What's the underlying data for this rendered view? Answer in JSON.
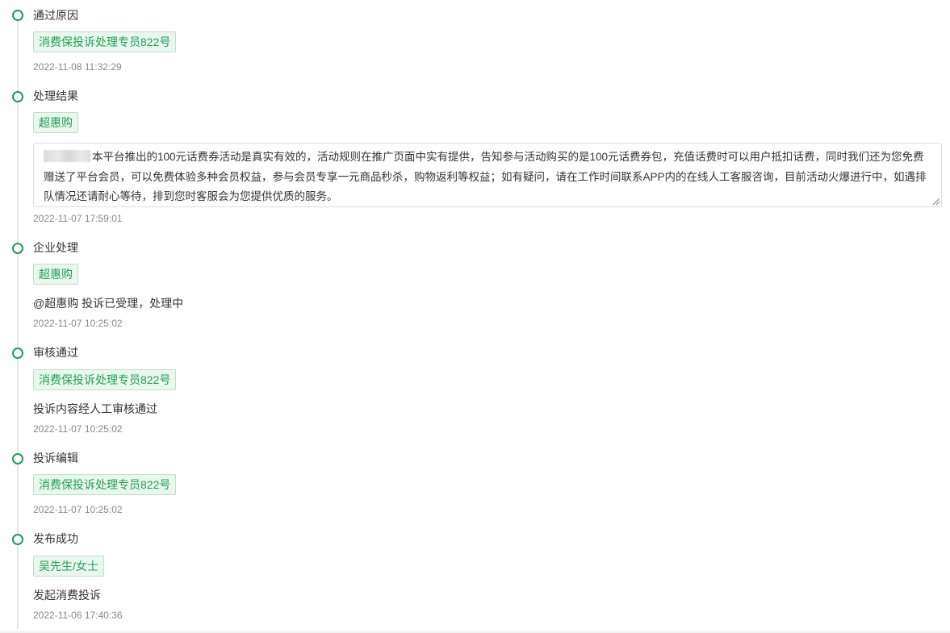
{
  "colors": {
    "accent_green": "#1e9a58",
    "tag_bg": "#e9f7ef",
    "tag_border": "#b8e3c8",
    "tag_text": "#22a055",
    "timeline_line": "#e4e7ed",
    "time_text": "#888888"
  },
  "timeline": {
    "items": [
      {
        "title": "通过原因",
        "tag": "消费保投诉处理专员822号",
        "time": "2022-11-08 11:32:29"
      },
      {
        "title": "处理结果",
        "tag": "超惠购",
        "content": "本平台推出的100元话费券活动是真实有效的，活动规则在推广页面中实有提供，告知参与活动购买的是100元话费券包，充值话费时可以用户抵扣话费，同时我们还为您免费赠送了平台会员，可以免费体验多种会员权益，参与会员专享一元商品秒杀，购物返利等权益；如有疑问，请在工作时间联系APP内的在线人工客服咨询，目前活动火爆进行中，如遇排队情况还请耐心等待，排到您时客服会为您提供优质的服务。",
        "time": "2022-11-07 17:59:01"
      },
      {
        "title": "企业处理",
        "tag": "超惠购",
        "desc": "@超惠购 投诉已受理，处理中",
        "time": "2022-11-07 10:25:02"
      },
      {
        "title": "审核通过",
        "tag": "消费保投诉处理专员822号",
        "desc": "投诉内容经人工审核通过",
        "time": "2022-11-07 10:25:02"
      },
      {
        "title": "投诉编辑",
        "tag": "消费保投诉处理专员822号",
        "time": "2022-11-07 10:25:02"
      },
      {
        "title": "发布成功",
        "tag": "吴先生/女士",
        "desc": "发起消费投诉",
        "time": "2022-11-06 17:40:36"
      }
    ]
  }
}
